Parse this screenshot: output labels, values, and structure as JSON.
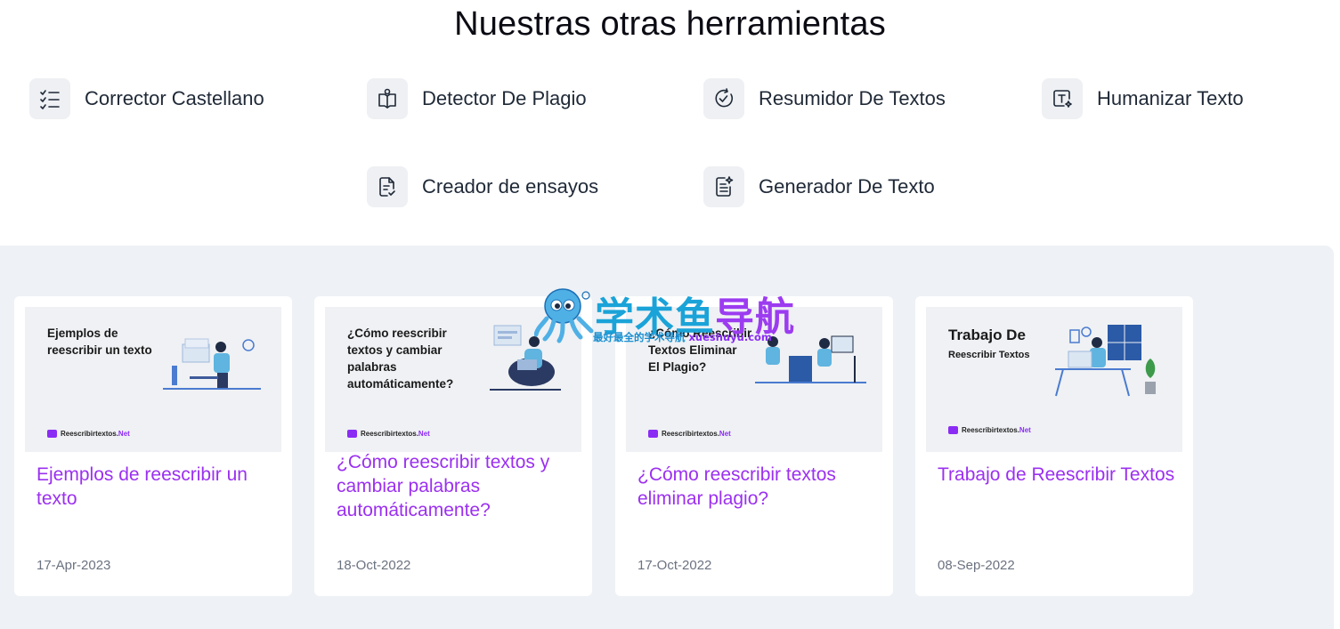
{
  "header": {
    "title": "Nuestras otras herramientas"
  },
  "tools": [
    {
      "label": "Corrector Castellano",
      "icon": "checklist-icon"
    },
    {
      "label": "Detector De Plagio",
      "icon": "open-book-icon"
    },
    {
      "label": "Resumidor De Textos",
      "icon": "circle-check-icon"
    },
    {
      "label": "Humanizar Texto",
      "icon": "text-sparkle-icon"
    },
    {
      "label": "Creador de ensayos",
      "icon": "document-check-icon"
    },
    {
      "label": "Generador De Texto",
      "icon": "document-sparkle-icon"
    }
  ],
  "articles": [
    {
      "thumb_text": "Ejemplos de\nreescribir un texto",
      "thumb_sub": "",
      "title": "Ejemplos de reescribir un texto",
      "date": "17-Apr-2023"
    },
    {
      "thumb_text": "¿Cómo reescribir\ntextos y cambiar\npalabras\nautomáticamente?",
      "thumb_sub": "",
      "title": "¿Cómo reescribir textos y cambiar palabras automáticamente?",
      "date": "18-Oct-2022"
    },
    {
      "thumb_text": "¿Cómo Reescribir\nTextos Eliminar\nEl Plagio?",
      "thumb_sub": "",
      "title": "¿Cómo reescribir textos eliminar plagio?",
      "date": "17-Oct-2022"
    },
    {
      "thumb_text": "Trabajo De",
      "thumb_sub": "Reescribir Textos",
      "title": "Trabajo de Reescribir Textos",
      "date": "08-Sep-2022"
    }
  ],
  "brand": {
    "name": "Reescribirtextos.",
    "tld": "Net"
  },
  "watermark": {
    "cn_part1": "学术鱼",
    "cn_part2": "导航",
    "sub": "最好最全的学术导航",
    "sub_url": "xueshuyu.com"
  },
  "colors": {
    "accent": "#9b30f0",
    "panel_bg": "#eef1f5",
    "watermark_blue": "#1aa3d8"
  }
}
